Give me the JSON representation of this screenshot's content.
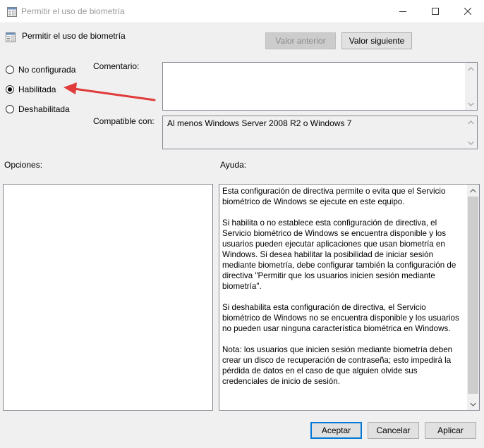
{
  "window": {
    "title": "Permitir el uso de biometría",
    "controls": [
      "minimize-icon",
      "maximize-icon",
      "close-icon"
    ]
  },
  "header": {
    "policy_name": "Permitir el uso de biometría",
    "prev_button": "Valor anterior",
    "next_button": "Valor siguiente"
  },
  "state": {
    "options": [
      {
        "label": "No configurada",
        "checked": false
      },
      {
        "label": "Habilitada",
        "checked": true
      },
      {
        "label": "Deshabilitada",
        "checked": false
      }
    ]
  },
  "comment": {
    "label": "Comentario:",
    "value": ""
  },
  "compat": {
    "label": "Compatible con:",
    "value": "Al menos Windows Server 2008 R2 o Windows 7"
  },
  "options_section": {
    "label": "Opciones:"
  },
  "help_section": {
    "label": "Ayuda:",
    "text": "Esta configuración de directiva permite o evita que el Servicio biométrico de Windows se ejecute en este equipo.\n\nSi habilita o no establece esta configuración de directiva, el Servicio biométrico de Windows se encuentra disponible y los usuarios pueden ejecutar aplicaciones que usan biometría en Windows. Si desea habilitar la posibilidad de iniciar sesión mediante biometría, debe configurar también la configuración de directiva \"Permitir que los usuarios inicien sesión mediante biometría\".\n\nSi deshabilita esta configuración de directiva, el Servicio biométrico de Windows no se encuentra disponible y los usuarios no pueden usar ninguna característica biométrica en Windows.\n\nNota: los usuarios que inicien sesión mediante biometría deben crear un disco de recuperación de contraseña; esto impedirá la pérdida de datos en el caso de que alguien olvide sus credenciales de inicio de sesión."
  },
  "footer": {
    "ok": "Aceptar",
    "cancel": "Cancelar",
    "apply": "Aplicar"
  },
  "colors": {
    "annotation_arrow": "#e03a3a",
    "default_button_border": "#0078d7"
  }
}
